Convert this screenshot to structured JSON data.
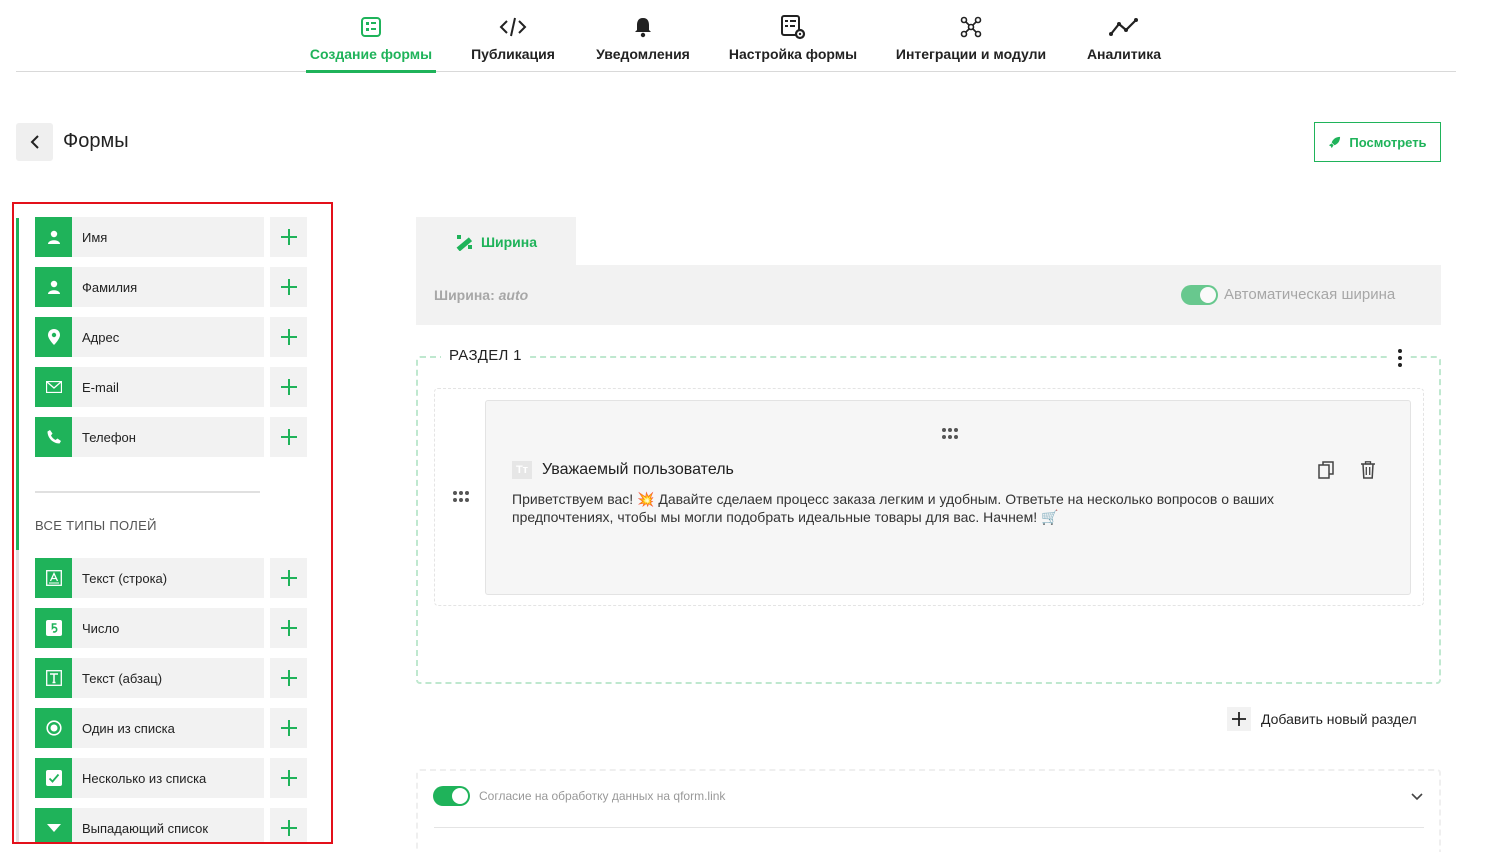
{
  "nav": {
    "tabs": [
      {
        "label": "Создание формы",
        "icon": "form-list-icon",
        "active": true
      },
      {
        "label": "Публикация",
        "icon": "code-icon",
        "active": false
      },
      {
        "label": "Уведомления",
        "icon": "bell-icon",
        "active": false
      },
      {
        "label": "Настройка формы",
        "icon": "form-settings-icon",
        "active": false
      },
      {
        "label": "Интеграции и модули",
        "icon": "integrations-icon",
        "active": false
      },
      {
        "label": "Аналитика",
        "icon": "analytics-icon",
        "active": false
      }
    ]
  },
  "header": {
    "title": "Формы",
    "preview_label": "Посмотреть"
  },
  "sidebar": {
    "contact_fields": [
      {
        "label": "Имя",
        "icon": "user-icon"
      },
      {
        "label": "Фамилия",
        "icon": "user-icon"
      },
      {
        "label": "Адрес",
        "icon": "location-pin-icon"
      },
      {
        "label": "E-mail",
        "icon": "envelope-icon"
      },
      {
        "label": "Телефон",
        "icon": "phone-icon"
      }
    ],
    "all_types_heading": "ВСЕ ТИПЫ ПОЛЕЙ",
    "field_types": [
      {
        "label": "Текст (строка)",
        "icon": "text-line-icon"
      },
      {
        "label": "Число",
        "icon": "number-icon"
      },
      {
        "label": "Текст (абзац)",
        "icon": "text-paragraph-icon"
      },
      {
        "label": "Один из списка",
        "icon": "radio-icon"
      },
      {
        "label": "Несколько из списка",
        "icon": "checkbox-icon"
      },
      {
        "label": "Выпадающий список",
        "icon": "dropdown-icon"
      }
    ]
  },
  "width_panel": {
    "tab_label": "Ширина",
    "label_prefix": "Ширина:",
    "value": "auto",
    "auto_label": "Автоматическая ширина",
    "auto_enabled": true
  },
  "section": {
    "title": "РАЗДЕЛ 1",
    "card": {
      "type_glyph": "Тт",
      "title": "Уважаемый пользователь",
      "text": "Приветствуем вас! 💥 Давайте сделаем процесс заказа легким и удобным. Ответьте на несколько вопросов о ваших предпочтениях, чтобы мы могли подобрать идеальные товары для вас. Начнем! 🛒"
    }
  },
  "add_section_label": "Добавить новый раздел",
  "consent": {
    "label": "Согласие на обработку данных на qform.link",
    "enabled": true
  },
  "colors": {
    "accent": "#1fb35a",
    "highlight_border": "#e3101a"
  }
}
